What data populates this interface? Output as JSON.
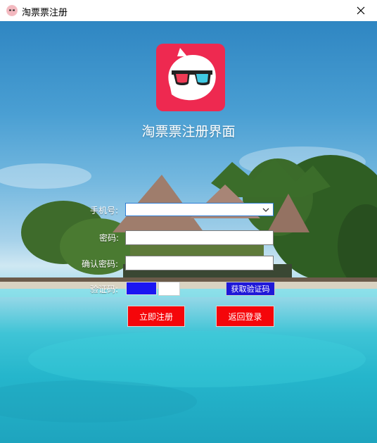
{
  "window": {
    "title": "淘票票注册"
  },
  "header": {
    "title": "淘票票注册界面"
  },
  "form": {
    "phone_label": "手机号:",
    "phone_value": "",
    "password_label": "密码:",
    "password_value": "",
    "confirm_label": "确认密码:",
    "confirm_value": "",
    "code_label": "验证码:",
    "code_value": "",
    "get_code_button": "获取验证码",
    "register_button": "立即注册",
    "back_button": "返回登录"
  },
  "colors": {
    "logo_bg": "#ee2950",
    "code_box": "#1b16f2",
    "get_code_button": "#1f18d8",
    "action_buttons": "#f5060a"
  },
  "icons": [
    "app-icon",
    "close-icon",
    "chevron-down-icon",
    "app-logo"
  ]
}
